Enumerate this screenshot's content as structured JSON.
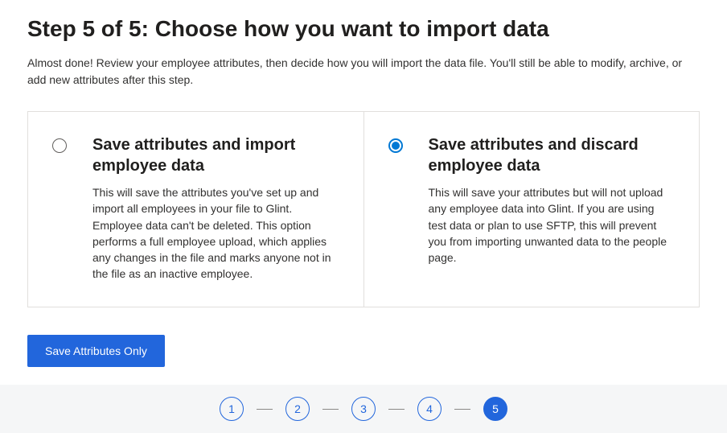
{
  "header": {
    "title": "Step 5 of 5: Choose how you want to import data",
    "description": "Almost done! Review your employee attributes, then decide how you will import the data file. You'll still be able to modify, archive, or add new attributes after this step."
  },
  "options": [
    {
      "title": "Save attributes and import employee data",
      "description": "This will save the attributes you've set up and import all employees in your file to Glint. Employee data can't be deleted. This option performs a full employee upload, which applies any changes in the file and marks anyone not in the file as an inactive employee.",
      "selected": false
    },
    {
      "title": "Save attributes and discard employee data",
      "description": "This will save your attributes but will not upload any employee data into Glint. If you are using test data or plan to use SFTP, this will prevent you from importing unwanted data to the people page.",
      "selected": true
    }
  ],
  "actions": {
    "primary_label": "Save Attributes Only"
  },
  "stepper": {
    "steps": [
      "1",
      "2",
      "3",
      "4",
      "5"
    ],
    "current": 5
  },
  "colors": {
    "primary": "#2266dc",
    "radio_selected": "#0078d4"
  }
}
